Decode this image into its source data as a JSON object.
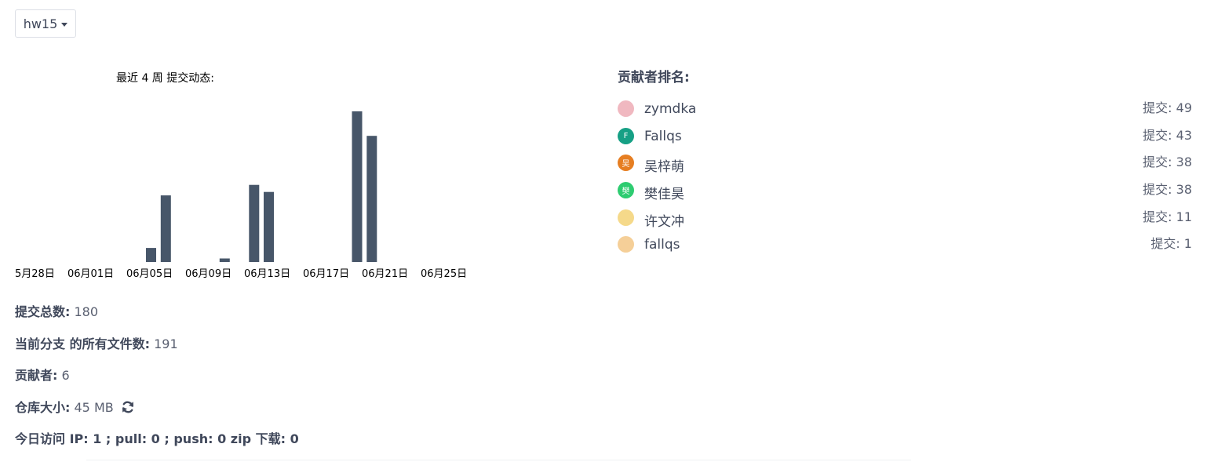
{
  "branch": {
    "label": "hw15"
  },
  "chart_data": {
    "type": "bar",
    "title": "最近 4 周 提交动态:",
    "color": "#475669",
    "tick_labels": [
      "5月28日",
      "06月01日",
      "06月05日",
      "06月09日",
      "06月13日",
      "06月17日",
      "06月21日",
      "06月25日"
    ],
    "x_start": "2024-05-28",
    "x_end": "2024-06-25",
    "dates": [
      "05-28",
      "05-29",
      "05-30",
      "05-31",
      "06-01",
      "06-02",
      "06-03",
      "06-04",
      "06-05",
      "06-06",
      "06-07",
      "06-08",
      "06-09",
      "06-10",
      "06-11",
      "06-12",
      "06-13",
      "06-14",
      "06-15",
      "06-16",
      "06-17",
      "06-18",
      "06-19",
      "06-20",
      "06-21",
      "06-22",
      "06-23",
      "06-24",
      "06-25"
    ],
    "values": [
      0,
      0,
      0,
      0,
      0,
      0,
      0,
      0,
      0,
      4,
      19,
      0,
      0,
      0,
      1,
      0,
      22,
      20,
      0,
      0,
      0,
      0,
      0,
      43,
      36,
      0,
      0,
      0,
      0
    ],
    "ylim": [
      0,
      45
    ]
  },
  "stats": {
    "total_commits": {
      "label": "提交总数:",
      "value": "180"
    },
    "file_count": {
      "label": "当前分支 的所有文件数:",
      "value": "191"
    },
    "contributors": {
      "label": "贡献者:",
      "value": "6"
    },
    "repo_size": {
      "label": "仓库大小:",
      "value": "45 MB"
    },
    "today_visits": {
      "label": "今日访问 IP: 1 ; pull: 0 ; push: 0 zip 下载: 0"
    }
  },
  "ranking": {
    "title": "贡献者排名:",
    "items": [
      {
        "name": "zymdka",
        "count": "提交: 49",
        "avatar_text": "",
        "avatar_color": "#f0b8c0"
      },
      {
        "name": "Fallqs",
        "count": "提交: 43",
        "avatar_text": "F",
        "avatar_color": "#16a085"
      },
      {
        "name": "吴梓萌",
        "count": "提交: 38",
        "avatar_text": "吴",
        "avatar_color": "#e67e22"
      },
      {
        "name": "樊佳昊",
        "count": "提交: 38",
        "avatar_text": "樊",
        "avatar_color": "#2ecc71"
      },
      {
        "name": "许文冲",
        "count": "提交: 11",
        "avatar_text": "",
        "avatar_color": "#f5d98a"
      },
      {
        "name": "fallqs",
        "count": "提交: 1",
        "avatar_text": "",
        "avatar_color": "#f5cf98"
      }
    ]
  }
}
